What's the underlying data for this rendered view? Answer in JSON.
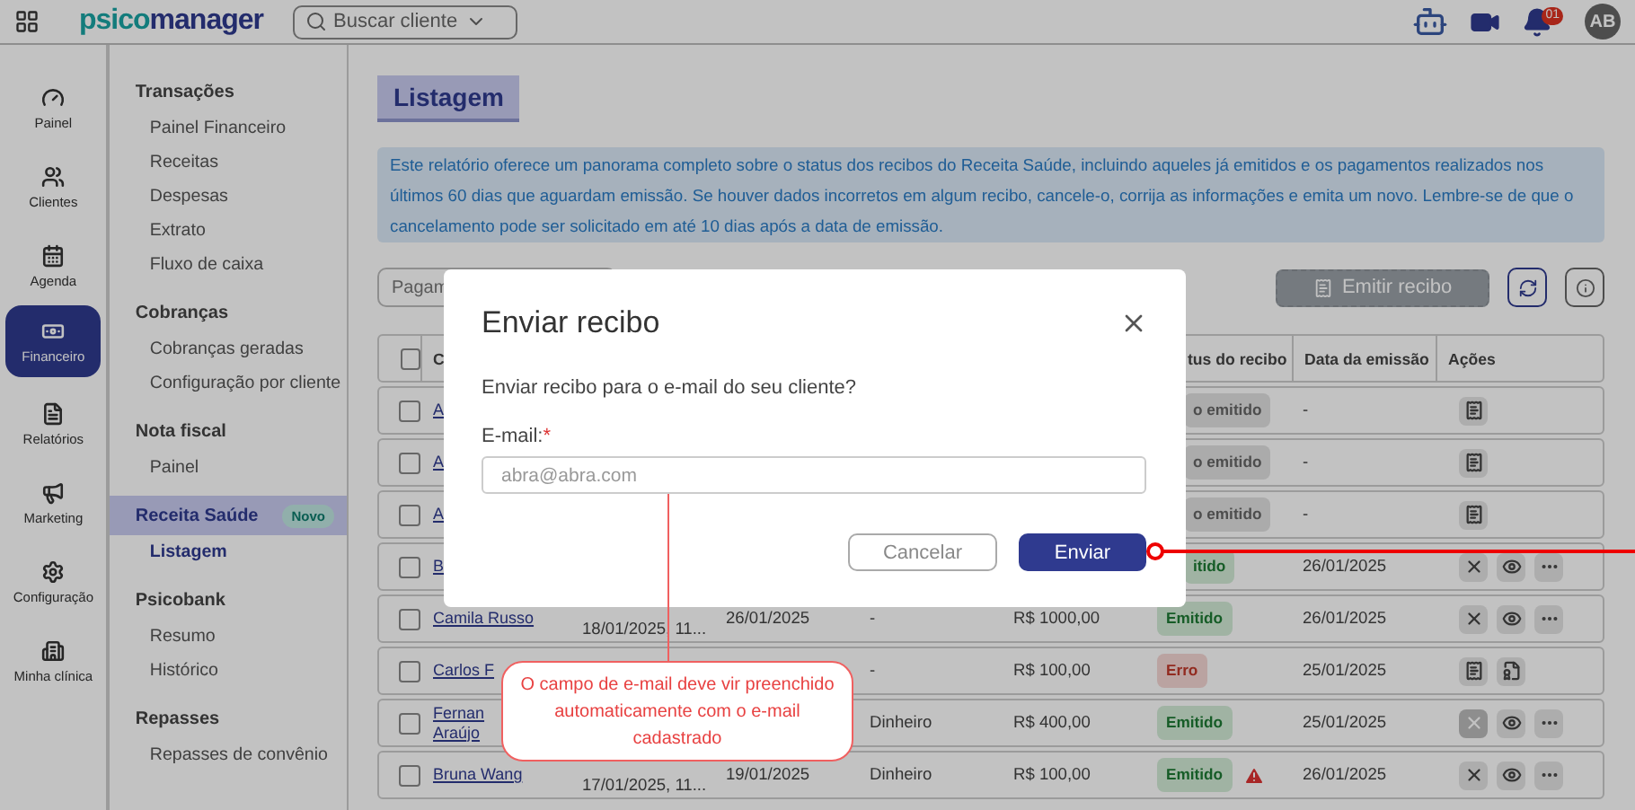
{
  "header": {
    "logo_part_1": "psico",
    "logo_part_2": "manager",
    "search": {
      "placeholder": "Buscar cliente"
    },
    "notification_count": "01",
    "avatar": "AB"
  },
  "rail": [
    {
      "label": "Painel",
      "kind": "gauge",
      "selected": false
    },
    {
      "label": "Clientes",
      "kind": "users",
      "selected": false
    },
    {
      "label": "Agenda",
      "kind": "calendar",
      "selected": false
    },
    {
      "label": "Financeiro",
      "kind": "money",
      "selected": true
    },
    {
      "label": "Relatórios",
      "kind": "document",
      "selected": false
    },
    {
      "label": "Marketing",
      "kind": "megaphone",
      "selected": false
    },
    {
      "label": "Configuração",
      "kind": "gear",
      "selected": false
    },
    {
      "label": "Minha clínica",
      "kind": "building",
      "selected": false
    }
  ],
  "menu": [
    {
      "title": "Transações",
      "selected": false,
      "items": [
        {
          "label": "Painel Financeiro",
          "selected": false
        },
        {
          "label": "Receitas",
          "selected": false
        },
        {
          "label": "Despesas",
          "selected": false
        },
        {
          "label": "Extrato",
          "selected": false
        },
        {
          "label": "Fluxo de caixa",
          "selected": false
        }
      ]
    },
    {
      "title": "Cobranças",
      "selected": false,
      "items": [
        {
          "label": "Cobranças geradas",
          "selected": false
        },
        {
          "label": "Configuração por cliente",
          "selected": false
        }
      ]
    },
    {
      "title": "Nota fiscal",
      "selected": false,
      "items": [
        {
          "label": "Painel",
          "selected": false
        }
      ]
    },
    {
      "title": "Receita Saúde",
      "badge": "Novo",
      "selected": true,
      "items": [
        {
          "label": "Listagem",
          "selected": true
        }
      ]
    },
    {
      "title": "Psicobank",
      "selected": false,
      "items": [
        {
          "label": "Resumo",
          "selected": false
        },
        {
          "label": "Histórico",
          "selected": false
        }
      ]
    },
    {
      "title": "Repasses",
      "selected": false,
      "items": [
        {
          "label": "Repasses de convênio",
          "selected": false
        }
      ]
    }
  ],
  "page": {
    "title": "Listagem",
    "info": "Este relatório oferece um panorama completo sobre o status dos recibos do Receita Saúde, incluindo aqueles já emitidos e os pagamentos realizados nos últimos 60 dias que aguardam emissão. Se houver dados incorretos em algum recibo, cancele-o, corrija as informações e emita um novo. Lembre-se de que o cancelamento pode ser solicitado em até 10 dias após a data de emissão.",
    "filter": {
      "placeholder": "Pagam"
    },
    "emit_button": {
      "label": "Emitir recibo",
      "disabled": true
    }
  },
  "table": {
    "select_all_checked": false,
    "columns": [
      "C",
      "",
      "",
      "",
      "",
      "tus do recibo",
      "Data da emissão",
      "Ações"
    ],
    "rows": [
      {
        "checked": false,
        "name": "A",
        "status": {
          "label": "o emitido",
          "kind": "pending"
        },
        "date": "-",
        "actions": [
          {
            "kind": "receipt",
            "disabled": false
          }
        ]
      },
      {
        "checked": false,
        "name": "A",
        "status": {
          "label": "o emitido",
          "kind": "pending"
        },
        "date": "-",
        "actions": [
          {
            "kind": "receipt",
            "disabled": false
          }
        ]
      },
      {
        "checked": false,
        "name": "A",
        "status": {
          "label": "o emitido",
          "kind": "pending"
        },
        "date": "-",
        "actions": [
          {
            "kind": "receipt",
            "disabled": false
          }
        ]
      },
      {
        "checked": false,
        "name": "B",
        "status": {
          "label": "itido",
          "kind": "ok"
        },
        "date": "26/01/2025",
        "actions": [
          {
            "kind": "cancel",
            "disabled": false
          },
          {
            "kind": "view",
            "disabled": false
          },
          {
            "kind": "more",
            "disabled": false
          }
        ]
      },
      {
        "checked": false,
        "name": "Camila Russo",
        "sessions": "18/01/2025, 11...",
        "col4": "26/01/2025",
        "method": "-",
        "amount": "R$ 1000,00",
        "status": {
          "label": "Emitido",
          "kind": "ok"
        },
        "date": "26/01/2025",
        "actions": [
          {
            "kind": "cancel",
            "disabled": false
          },
          {
            "kind": "view",
            "disabled": false
          },
          {
            "kind": "more",
            "disabled": false
          }
        ]
      },
      {
        "checked": false,
        "name": "Carlos F",
        "method": "-",
        "amount": "R$ 100,00",
        "status": {
          "label": "Erro",
          "kind": "error"
        },
        "date": "25/01/2025",
        "actions": [
          {
            "kind": "receipt",
            "disabled": false
          },
          {
            "kind": "file",
            "disabled": false
          }
        ]
      },
      {
        "checked": false,
        "name": "Fernan\nAraújo",
        "method": "Dinheiro",
        "amount": "R$ 400,00",
        "status": {
          "label": "Emitido",
          "kind": "ok"
        },
        "date": "25/01/2025",
        "actions": [
          {
            "kind": "cancel",
            "disabled": true
          },
          {
            "kind": "view",
            "disabled": false
          },
          {
            "kind": "more",
            "disabled": false
          }
        ]
      },
      {
        "checked": false,
        "name": "Bruna Wang",
        "sessions": "17/01/2025, 11...",
        "col4": "19/01/2025",
        "method": "Dinheiro",
        "amount": "R$ 100,00",
        "status": {
          "label": "Emitido",
          "kind": "ok"
        },
        "warning": true,
        "date": "26/01/2025",
        "actions": [
          {
            "kind": "cancel",
            "disabled": false
          },
          {
            "kind": "view",
            "disabled": false
          },
          {
            "kind": "more",
            "disabled": false
          }
        ]
      }
    ]
  },
  "dialog": {
    "title": "Enviar recibo",
    "question": "Enviar recibo para o e-mail do seu cliente?",
    "email_label": "E-mail:",
    "required_mark": "*",
    "email_placeholder": "abra@abra.com",
    "buttons": [
      {
        "label": "Cancelar",
        "kind": "secondary"
      },
      {
        "label": "Enviar",
        "kind": "primary"
      }
    ]
  },
  "annotation": {
    "text": "O campo de e-mail deve vir preenchido automaticamente com o e-mail cadastrado"
  }
}
